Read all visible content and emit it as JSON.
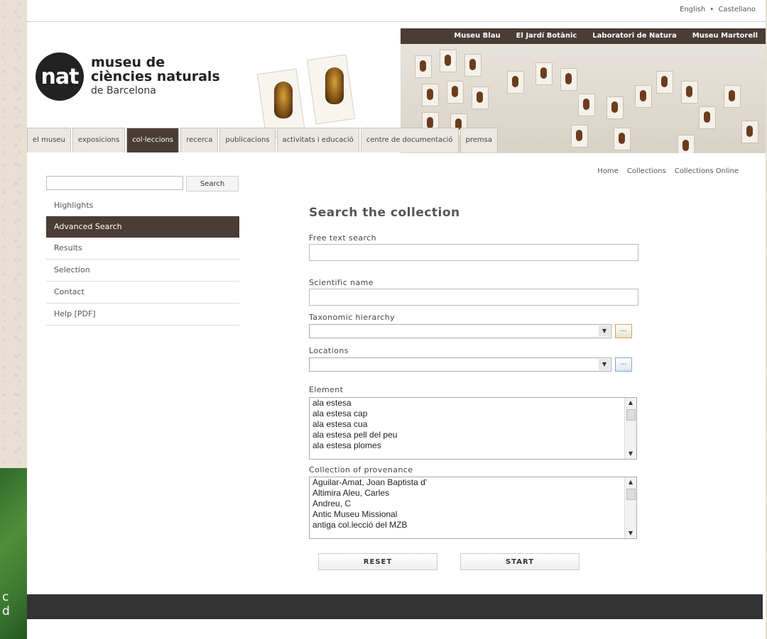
{
  "language": {
    "english": "English",
    "separator": "•",
    "castellano": "Castellano"
  },
  "header_nav": [
    "Museu Blau",
    "El Jardí Botànic",
    "Laboratori de Natura",
    "Museu Martorell"
  ],
  "logo": {
    "mark": "nat",
    "line1": "museu de",
    "line2": "ciències naturals",
    "line3": "de Barcelona"
  },
  "main_nav": {
    "items": [
      "el museu",
      "exposicions",
      "col·leccions",
      "recerca",
      "publicacions",
      "activitats i educació",
      "centre de documentació",
      "premsa"
    ],
    "active": "col·leccions"
  },
  "breadcrumb": [
    "Home",
    "Collections",
    "Collections Online"
  ],
  "sidebar": {
    "search_button": "Search",
    "menu": [
      "Highlights",
      "Advanced Search",
      "Results",
      "Selection",
      "Contact",
      "Help [PDF]"
    ],
    "active": "Advanced Search"
  },
  "form": {
    "title": "Search the collection",
    "free_text_label": "Free text search",
    "scientific_name_label": "Scientific name",
    "taxonomic_label": "Taxonomic hierarchy",
    "locations_label": "Locations",
    "browse_label": "...",
    "element_label": "Element",
    "element_options": [
      "ala estesa",
      "ala estesa cap",
      "ala estesa cua",
      "ala estesa pell del peu",
      "ala estesa plomes"
    ],
    "provenance_label": "Collection of provenance",
    "provenance_options": [
      "Aguilar-Amat, Joan Baptista d'",
      "Altimira Aleu, Carles",
      "Andreu, C",
      "Antic Museu Missional",
      "antiga col.lecció del MZB"
    ],
    "reset_label": "RESET",
    "start_label": "START"
  },
  "deco_letters": "c\nd"
}
